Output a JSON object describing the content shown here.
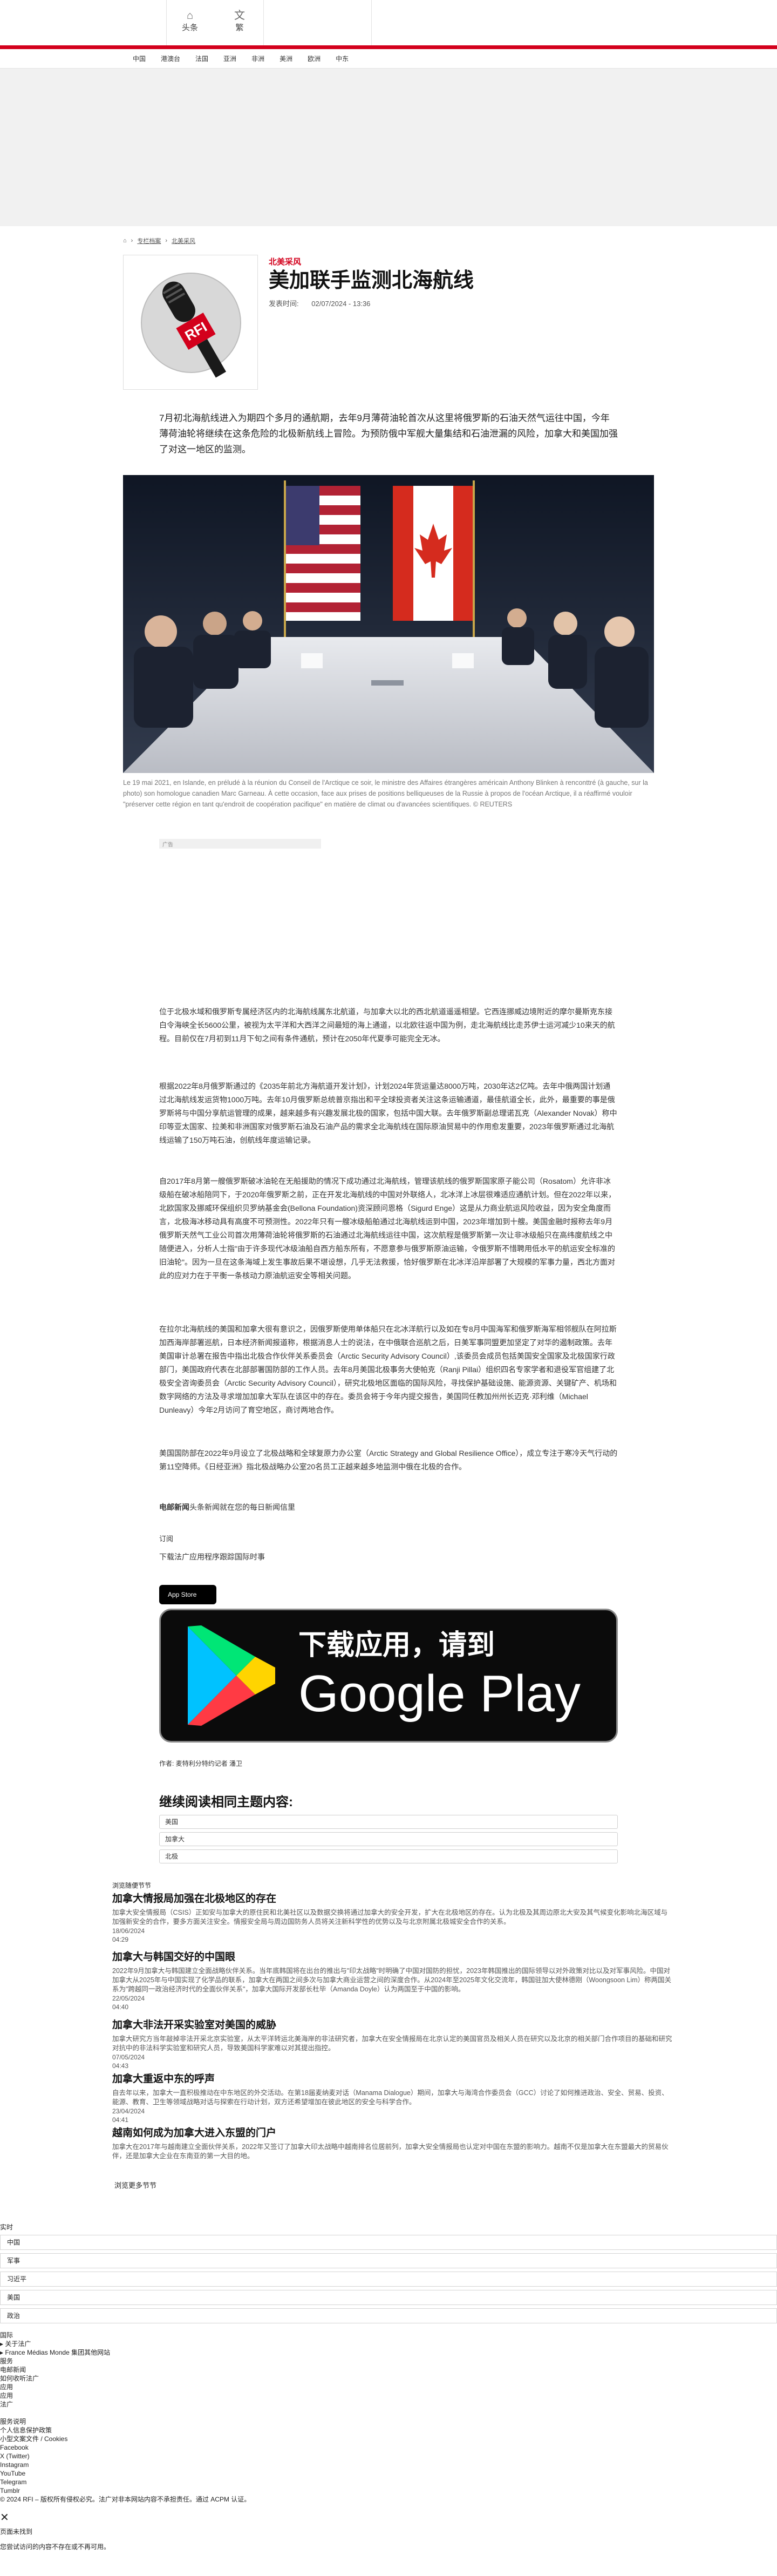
{
  "header": {
    "home_label": "头条",
    "lang_label": "繁",
    "nav": [
      "中国",
      "港澳台",
      "法国",
      "亚洲",
      "非洲",
      "美洲",
      "欧洲",
      "中东"
    ]
  },
  "breadcrumb": [
    "专栏档案",
    "北美采风"
  ],
  "article": {
    "kicker": "北美采风",
    "title": "美加联手监测北海航线",
    "published_label": "发表时间:",
    "published_date": "02/07/2024 - 13:36",
    "lead": "7月初北海航线进入为期四个多月的通航期，去年9月薄荷油轮首次从这里将俄罗斯的石油天然气运往中国，今年薄荷油轮将继续在这条危险的北极新航线上冒险。为预防俄中军舰大量集结和石油泄漏的风险，加拿大和美国加强了对这一地区的监测。",
    "photo_caption": "Le 19 mai 2021, en Islande, en préludé à la réunion du Conseil de l'Arctique ce soir, le ministre des Affaires étrangères américain Anthony Blinken à renconttré (à gauche, sur la photo) son homologue canadien Marc Garneau. À cette occasion, face aux prises de positions belliqueuses de la Russie à propos de l'océan Arctique, il a réaffirmé vouloir \"préserver cette région en tant qu'endroit de coopération pacifique\" en matière de climat ou d'avancées scientifiques. © REUTERS",
    "ad_label": "广告",
    "paragraphs": [
      "位于北极水域和俄罗斯专属经济区内的北海航线属东北航道，与加拿大以北的西北航道遥遥相望。它西连挪威边境附近的摩尔曼斯克东接白令海峡全长5600公里，被视为太平洋和大西洋之间最短的海上通道，以北欧往返中国为例，走北海航线比走苏伊士运河减少10来天的航程。目前仅在7月初到11月下旬之间有条件通航，预计在2050年代夏季可能完全无冰。",
      "根据2022年8月俄罗斯通过的《2035年前北方海航道开发计划》，计划2024年货运量达8000万吨，2030年达2亿吨。去年中俄两国计划通过北海航线发运货物1000万吨。去年10月俄罗斯总统普京指出和平全球投资者关注这条运输通道，最佳航道全长，此外，最重要的事是俄罗斯将与中国分享航运管理的成果，越来越多有兴趣发展北极的国家，包括中国大联。去年俄罗斯副总理诺瓦克（Alexander Novak）称中印等亚太国家、拉美和非洲国家对俄罗斯石油及石油产品的需求全北海航线在国际原油贸易中的作用愈发重要，2023年俄罗斯通过北海航线运输了150万吨石油，创航线年度运输记录。",
      "自2017年8月第一艘俄罗斯破冰油轮在无船援助的情况下成功通过北海航线，管理该航线的俄罗斯国家原子能公司（Rosatom）允许非冰级船在破冰船陪同下，于2020年俄罗斯之前，正在开发北海航线的中国对外联络人，北冰洋上冰层很难适应通航计划。但在2022年以来，北欧国家及挪威环保组织贝罗纳基金会(Bellona Foundation)资深顾问恩格（Sigurd Enge）这是从力商业航运风险收益，因为安全角度而言，北极海冰移动具有高度不可预测性。2022年只有一艘冰级船舶通过北海航线运到中国，2023年增加到十艘。美国金融时报称去年9月俄罗斯天然气工业公司首次用薄荷油轮将俄罗斯的石油通过北海航线运往中国，这次航程是俄罗斯第一次让非冰级船只在高纬度航线之中随便进入，分析人士指\"由于许多现代冰级油船自西方船东所有，不愿意参与俄罗斯原油运输，令俄罗斯不惜聘用低水平的航运安全标准的旧油轮\"。因为一旦在这条海域上发生事故后果不堪设想，几乎无法救援，恰好俄罗斯在北冰洋沿岸部署了大规模的军事力量，西北方面对此的应对力在于平衡一条核动力原油航运安全等相关问题。",
      "在拉尔北海航线的美国和加拿大很有意识之，因俄罗斯使用单体船只在北冰洋航行以及如在专8月中国海军和俄罗斯海军相邻舰队在阿拉斯加西海岸部署巡航，日本经济新闻报道称，根据消息人士的说法，在中俄联合巡航之后，日美军事同盟更加坚定了对华的遏制政策。去年美国审计总署在报告中指出北极合作伙伴关系委员会（Arctic Security Advisory Council）,该委员会成员包括美国安全国家及北极国家行政部门，美国政府代表在北部部署国防部的工作人员。去年8月美国北极事务大使帕克（Ranji Pillai）组织四名专家学者和退役军官组建了北极安全咨询委员会（Arctic Security Advisory Council），研究北极地区面临的国际风险，寻找保护基础设施、能源资源、关键矿产、机场和数字网络的方法及寻求增加加拿大军队在该区中的存在。委员会将于今年内提交报告，美国同任教加州州长迈克·邓利维（Michael Dunleavy）今年2月访问了育空地区，商讨两地合作。",
      "美国国防部在2022年9月设立了北极战略和全球复原力办公室（Arctic Strategy and Global Resilience Office），成立专注于寒冷天气行动的第11空降师。《日经亚洲》指北极战略办公室20名员工正越来越多地监测中俄在北极的合作。"
    ],
    "newsletter_prefix": "电邮新闻",
    "newsletter_text": "头条新闻就在您的每日新闻信里",
    "subscribe": "订阅",
    "download_prompt": "下载法广应用程序跟踪国际时事",
    "appstore_label": "App Store",
    "gplay_top": "下载应用，请到",
    "gplay_bottom": "Google Play",
    "author_label": "作者:",
    "author": "麦特利分特约记者 潘卫"
  },
  "related_topics": {
    "heading": "继续阅读相同主题内容:",
    "tags": [
      "美国",
      "加拿大",
      "北极"
    ]
  },
  "column_more": {
    "label": "浏览随便节节",
    "items": [
      {
        "title": "加拿大情报局加强在北极地区的存在",
        "desc": "加拿大安全情报局（CSIS）正如安与加拿大的原住民和北美社区以及数据交换将通过加拿大的安全开发，扩大在北极地区的存在。认为北极及其周边原北大安及其气候变化影响北海区域与加强新安全的合作，要多方面关注安全。情报安全局与周边国防务人员将关注新科学性的优势以及与北京附属北极城安全合作的关系。",
        "date": "18/06/2024",
        "time": "04:29"
      },
      {
        "title": "加拿大与韩国交好的中国眼",
        "desc": "2022年9月加拿大与韩国建立全面战略伙伴关系。当年底韩国将在出台的推出与\"印太战略\"时明确了中国对国防的担忧，2023年韩国推出的国际领导以对外政策对比以及对军事风险。中国对加拿大从2025年与中国实现了化学品的联系，加拿大在两国之间多次与加拿大商业运营之间的深度合作。从2024年至2025年文化交流年，韩国驻加大使林德刚（Woongsoon Lim）称两国关系为\"跨越同一政治经济时代的全面伙伴关系\"，加拿大国际开发部长杜毕（Amanda Doyle）认为两国至于中国的影响。",
        "date": "22/05/2024",
        "time": "04:40"
      },
      {
        "title": "加拿大非法开采实验室对美国的威胁",
        "desc": "加拿大研究方当年敲掉非法开采北京实验室，从太平洋转运北美海岸的非法研究者，加拿大在安全情报局在北京认定的美国官员及相关人员在研究以及北京的相关部门合作项目的基础和研究对抗中的非法科学实验室和研究人员，导致美国科学家难以对其提出指控。",
        "date": "07/05/2024",
        "time": "04:43"
      },
      {
        "title": "加拿大重返中东的呼声",
        "desc": "自去年以来，加拿大一直积极推动在中东地区的外交活动。在第18届麦纳麦对话（Manama Dialogue）期间，加拿大与海湾合作委员会（GCC）讨论了如何推进政治、安全、贸易、投资、能源、教育、卫生等领域战略对话与探索在行动计划，双方还希望增加在彼此地区的安全与科学合作。",
        "date": "23/04/2024",
        "time": "04:41"
      },
      {
        "title": "越南如何成为加拿大进入东盟的门户",
        "desc": "加拿大在2017年与越南建立全面伙伴关系，2022年又签订了加拿大印太战略中越南排名位居前列，加拿大安全情报局也认定对中国在东盟的影响力。越南不仅是加拿大在东盟最大的贸易伙伴，还是加拿大企业在东南亚的第一大目的地。",
        "date": "",
        "time": ""
      }
    ],
    "more_link": "浏览更多节节"
  },
  "footer": {
    "live_label": "实时",
    "fields": [
      "中国",
      "军事",
      "习近平",
      "美国",
      "政治"
    ],
    "lines": [
      "国际",
      "关于法广",
      "France Médias Monde 集团其他网站",
      "服务",
      "电邮新闻",
      "如何收听法广",
      "应用",
      "应用",
      "法广"
    ],
    "lines2": [
      "服务说明",
      "个人信息保护政策",
      "小型文案文件 / Cookies",
      "Facebook",
      "X (Twitter)",
      "Instagram",
      "YouTube",
      "Telegram",
      "Tumblr"
    ],
    "copyright": "© 2024 RFI – 版权所有侵权必究。法广对非本网站内容不承担责任。通过 ACPM 认证。",
    "close_glyph": "✕",
    "notfound_title": "页面未找到",
    "notfound_text": "您尝试访问的内容不存在或不再可用。"
  },
  "colors": {
    "brand_red": "#d3001c",
    "ad_grey": "#f1f1f1"
  }
}
